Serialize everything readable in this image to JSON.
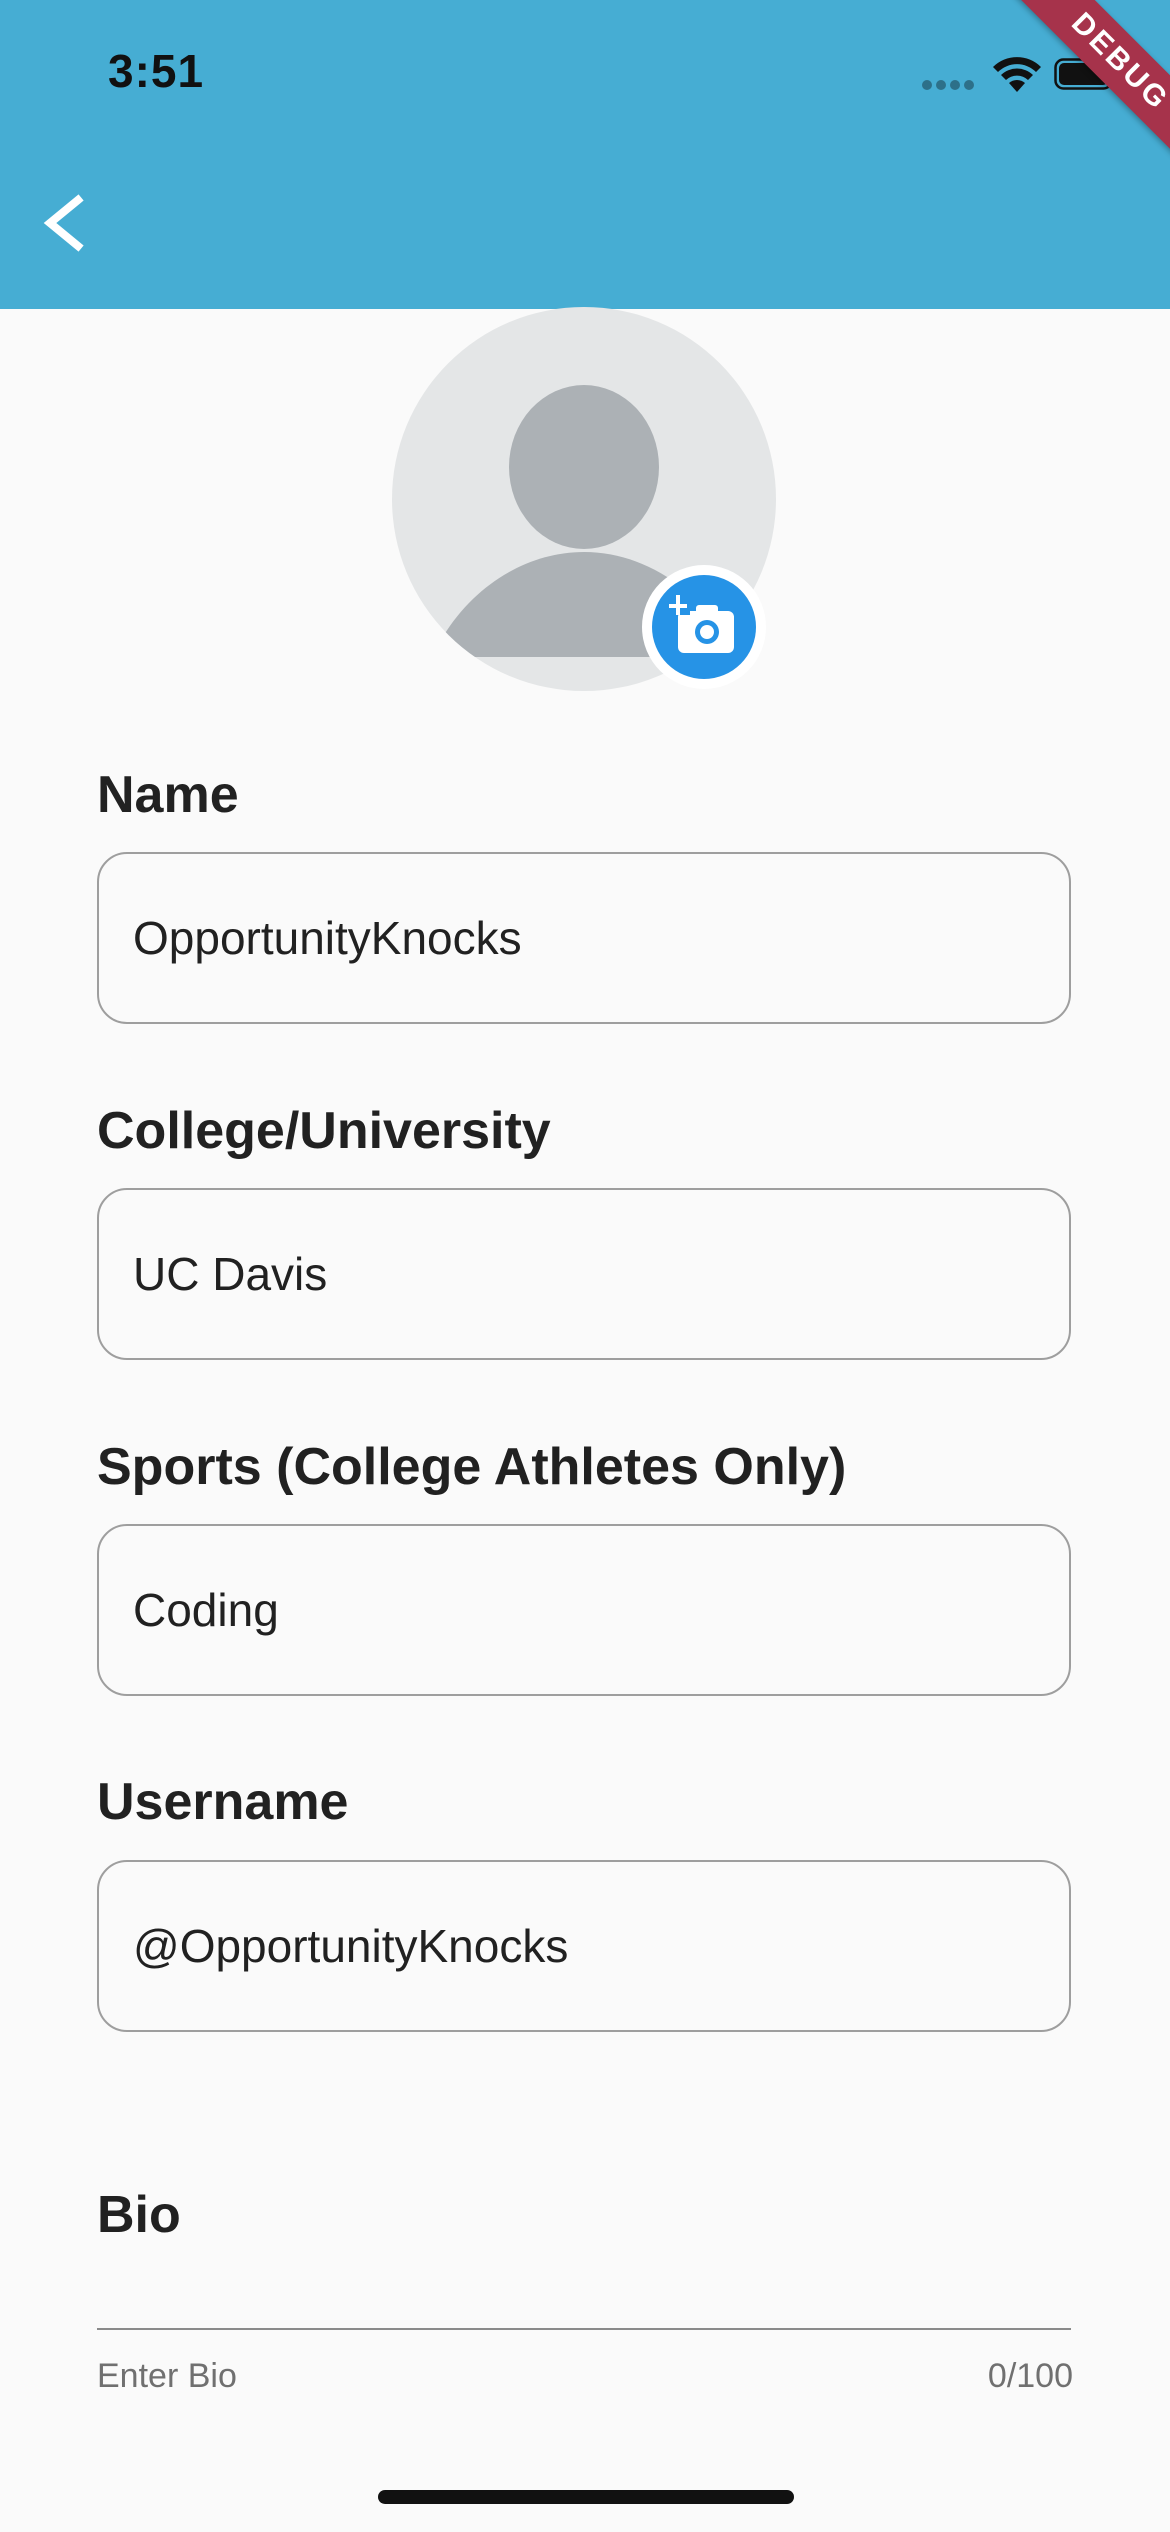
{
  "status_bar": {
    "time": "3:51",
    "icons": [
      "signal-icon",
      "wifi-icon",
      "battery-icon"
    ]
  },
  "debug_banner": "DEBUG",
  "app_bar": {
    "color": "#46add3",
    "back_icon": "chevron-left-icon"
  },
  "profile": {
    "avatar_icon": "default-avatar-icon",
    "camera_icon": "add-photo-camera-icon",
    "accent_color": "#2693e6"
  },
  "form": {
    "name": {
      "label": "Name",
      "value": "OpportunityKnocks"
    },
    "college": {
      "label": "College/University",
      "value": "UC Davis"
    },
    "sports": {
      "label": "Sports (College Athletes Only)",
      "value": "Coding"
    },
    "username": {
      "label": "Username",
      "value": "@OpportunityKnocks"
    },
    "bio": {
      "label": "Bio",
      "value": "",
      "hint": "Enter Bio",
      "counter": "0/100"
    }
  }
}
